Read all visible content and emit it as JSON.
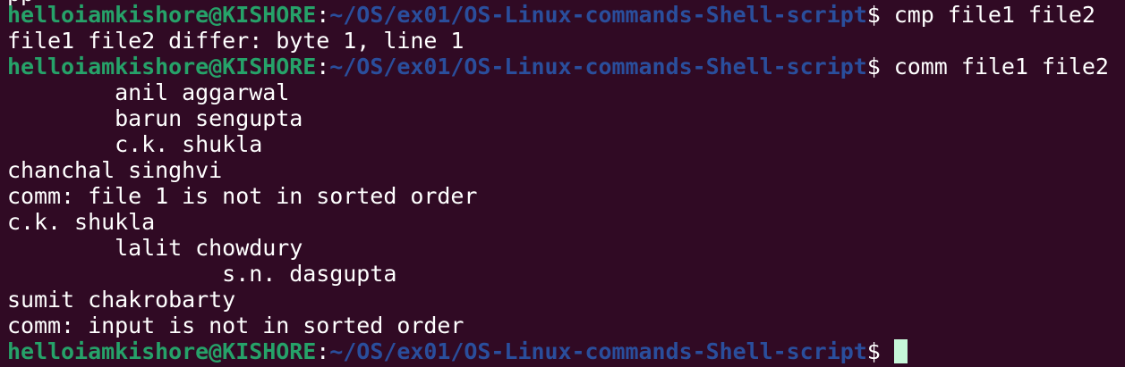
{
  "terminal": {
    "partial_top": "pp",
    "prompt": {
      "user": "helloiamkishore@KISHORE",
      "sep": ":",
      "path": "~/OS/ex01/OS-Linux-commands-Shell-script",
      "symbol": "$ "
    },
    "lines": [
      {
        "kind": "prompt",
        "cmd": "cmp file1 file2"
      },
      {
        "kind": "output",
        "text": "file1 file2 differ: byte 1, line 1"
      },
      {
        "kind": "prompt",
        "cmd": "comm file1 file2"
      },
      {
        "kind": "output",
        "text": "        anil aggarwal"
      },
      {
        "kind": "output",
        "text": "        barun sengupta"
      },
      {
        "kind": "output",
        "text": "        c.k. shukla"
      },
      {
        "kind": "output",
        "text": "chanchal singhvi"
      },
      {
        "kind": "output",
        "text": "comm: file 1 is not in sorted order"
      },
      {
        "kind": "output",
        "text": "c.k. shukla"
      },
      {
        "kind": "output",
        "text": "        lalit chowdury"
      },
      {
        "kind": "output",
        "text": "                s.n. dasgupta"
      },
      {
        "kind": "output",
        "text": "sumit chakrobarty"
      },
      {
        "kind": "output",
        "text": "comm: input is not in sorted order"
      },
      {
        "kind": "prompt",
        "cmd": ""
      }
    ]
  }
}
